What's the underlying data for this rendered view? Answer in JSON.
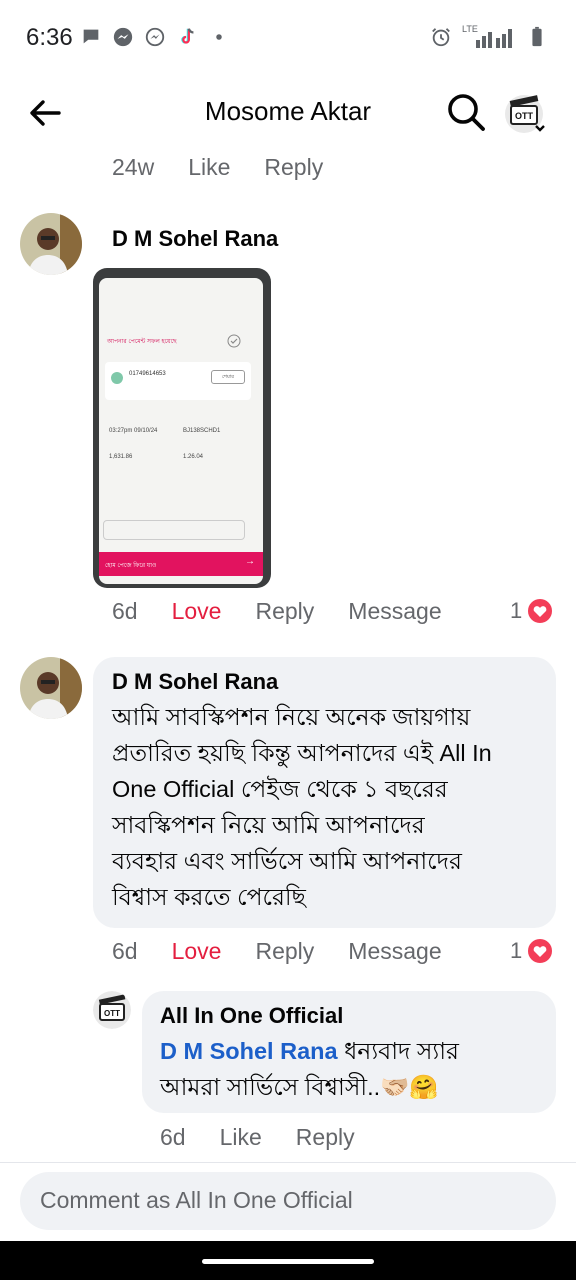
{
  "status_bar": {
    "time": "6:36",
    "network": "LTE"
  },
  "header": {
    "title": "Mosome Aktar"
  },
  "prev_comment_meta": {
    "age": "24w",
    "like": "Like",
    "reply": "Reply"
  },
  "comments": [
    {
      "author": "D M Sohel Rana",
      "meta": {
        "age": "6d",
        "reaction": "Love",
        "reply": "Reply",
        "message": "Message"
      },
      "reaction_count": "1",
      "photo": {
        "header_text": "আপনার পেমেন্ট সফল হয়েছে",
        "number": "01749614653",
        "button": "শেয়ার",
        "time": "03:27pm 09/10/24",
        "trx_id": "BJ138SCHD1",
        "amount": "1,631.86",
        "charge": "1.26.04",
        "home_button": "হোম পেজে ফিরে যাও"
      }
    },
    {
      "author": "D M Sohel Rana",
      "text_lines": [
        "আমি সাবস্কিপশন নিয়ে অনেক জায়গায়",
        "প্রতারিত হয়ছি কিন্তু আপনাদের এই All In",
        "One Official  পেইজ থেকে ১ বছরের",
        "সাবস্কিপশন নিয়ে আমি আপনাদের",
        "ব্যবহার এবং সার্ভিসে  আমি আপনাদের",
        "বিশ্বাস করতে পেরেছি"
      ],
      "meta": {
        "age": "6d",
        "reaction": "Love",
        "reply": "Reply",
        "message": "Message"
      },
      "reaction_count": "1"
    }
  ],
  "reply": {
    "author": "All In One Official",
    "mention": "D M Sohel Rana",
    "text_line1": " ধন্যবাদ স্যার",
    "text_line2": "আমরা সার্ভিসে বিশ্বাসী..🫱🏻‍🫲🏼🤗",
    "meta": {
      "age": "6d",
      "like": "Like",
      "reply": "Reply"
    }
  },
  "composer": {
    "placeholder": "Comment as All In One Official"
  },
  "colors": {
    "love": "#e41e3f",
    "mention": "#1c5fc9",
    "bubble": "#f0f2f5",
    "meta": "#65676b"
  }
}
